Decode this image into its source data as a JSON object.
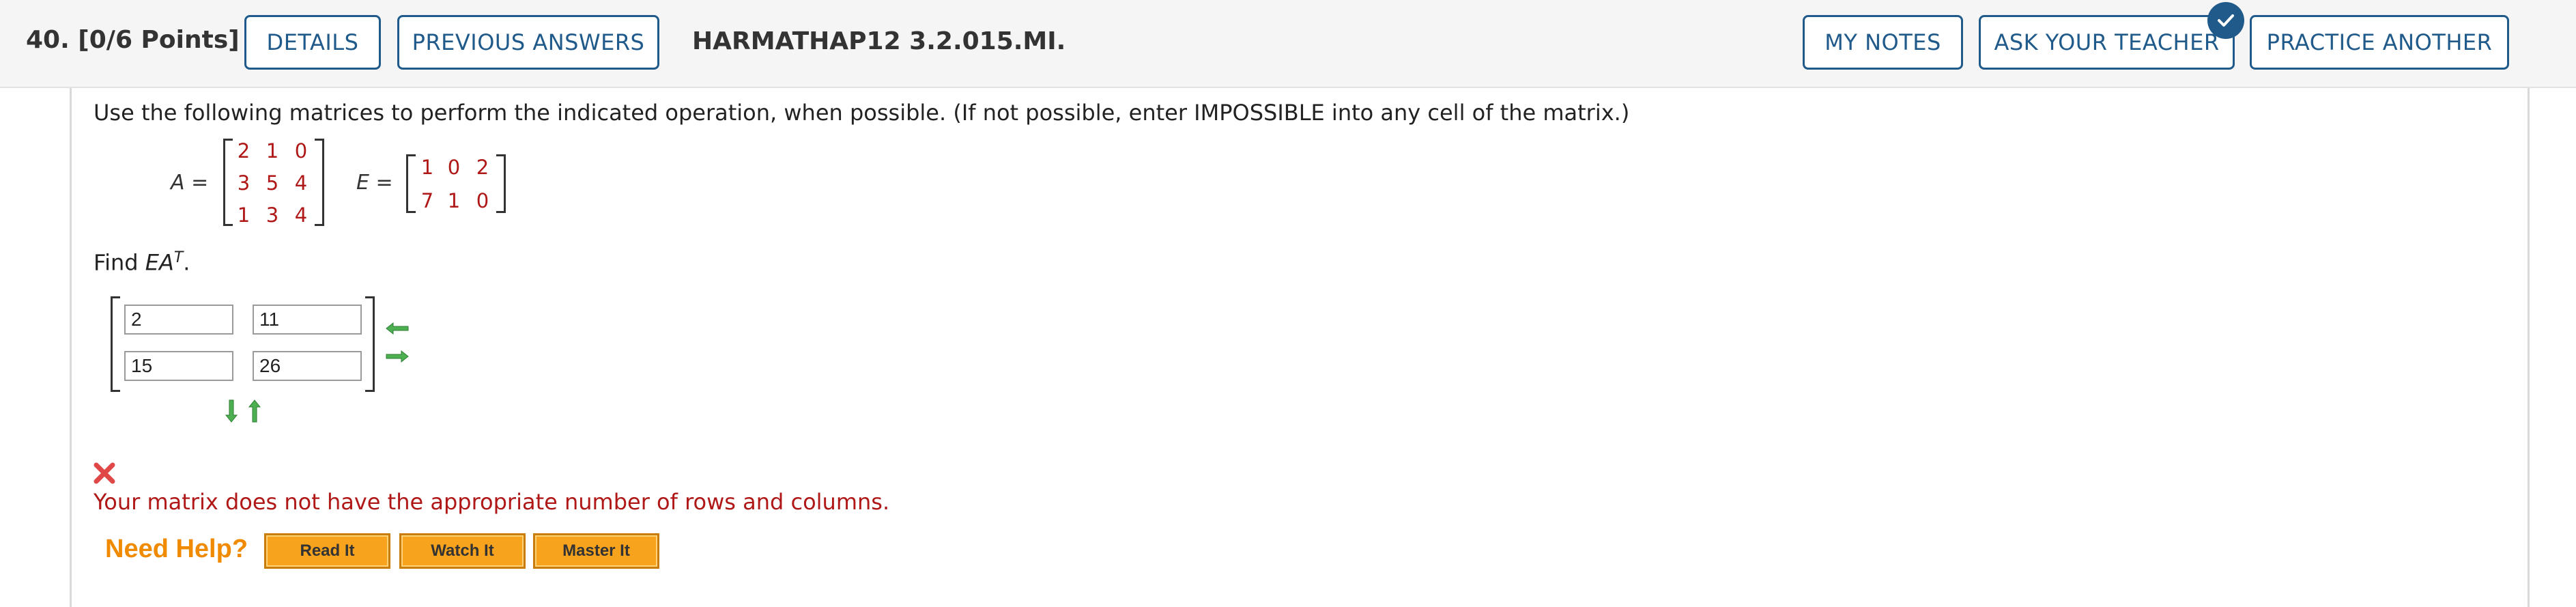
{
  "header": {
    "question_label": "40.  [0/6 Points]",
    "buttons": {
      "details": "DETAILS",
      "previous_answers": "PREVIOUS ANSWERS",
      "my_notes": "MY NOTES",
      "ask_teacher": "ASK YOUR TEACHER",
      "practice_another": "PRACTICE ANOTHER"
    },
    "assignment_code": "HARMATHAP12 3.2.015.MI."
  },
  "problem": {
    "instructions": "Use the following matrices to perform the indicated operation, when possible. (If not possible, enter IMPOSSIBLE into any cell of the matrix.)",
    "matrix_a": {
      "name": "A",
      "equals": " =",
      "rows": [
        [
          "2",
          "1",
          "0"
        ],
        [
          "3",
          "5",
          "4"
        ],
        [
          "1",
          "3",
          "4"
        ]
      ]
    },
    "matrix_e": {
      "name": "E",
      "equals": " =",
      "rows": [
        [
          "1",
          "0",
          "2"
        ],
        [
          "7",
          "1",
          "0"
        ]
      ]
    },
    "find": {
      "prefix": "Find ",
      "expr": "EA",
      "superscript": "T",
      "suffix": "."
    }
  },
  "answer": {
    "cells": [
      [
        "2",
        "11"
      ],
      [
        "15",
        "26"
      ]
    ]
  },
  "feedback": {
    "error_message": "Your matrix does not have the appropriate number of rows and columns."
  },
  "help": {
    "label": "Need Help?",
    "buttons": {
      "read": "Read It",
      "watch": "Watch It",
      "master": "Master It"
    }
  },
  "colors": {
    "accent": "#1f5a8a",
    "matrix_entry": "#b01818",
    "error": "#b01818",
    "help_orange": "#f08a00",
    "arrow_green": "#4caf50"
  },
  "icons": {
    "checkmark": "check-badge-icon",
    "error": "x-mark-icon",
    "matrix_controls": [
      "arrow-left-icon",
      "arrow-right-icon",
      "arrow-down-icon",
      "arrow-up-icon"
    ]
  }
}
